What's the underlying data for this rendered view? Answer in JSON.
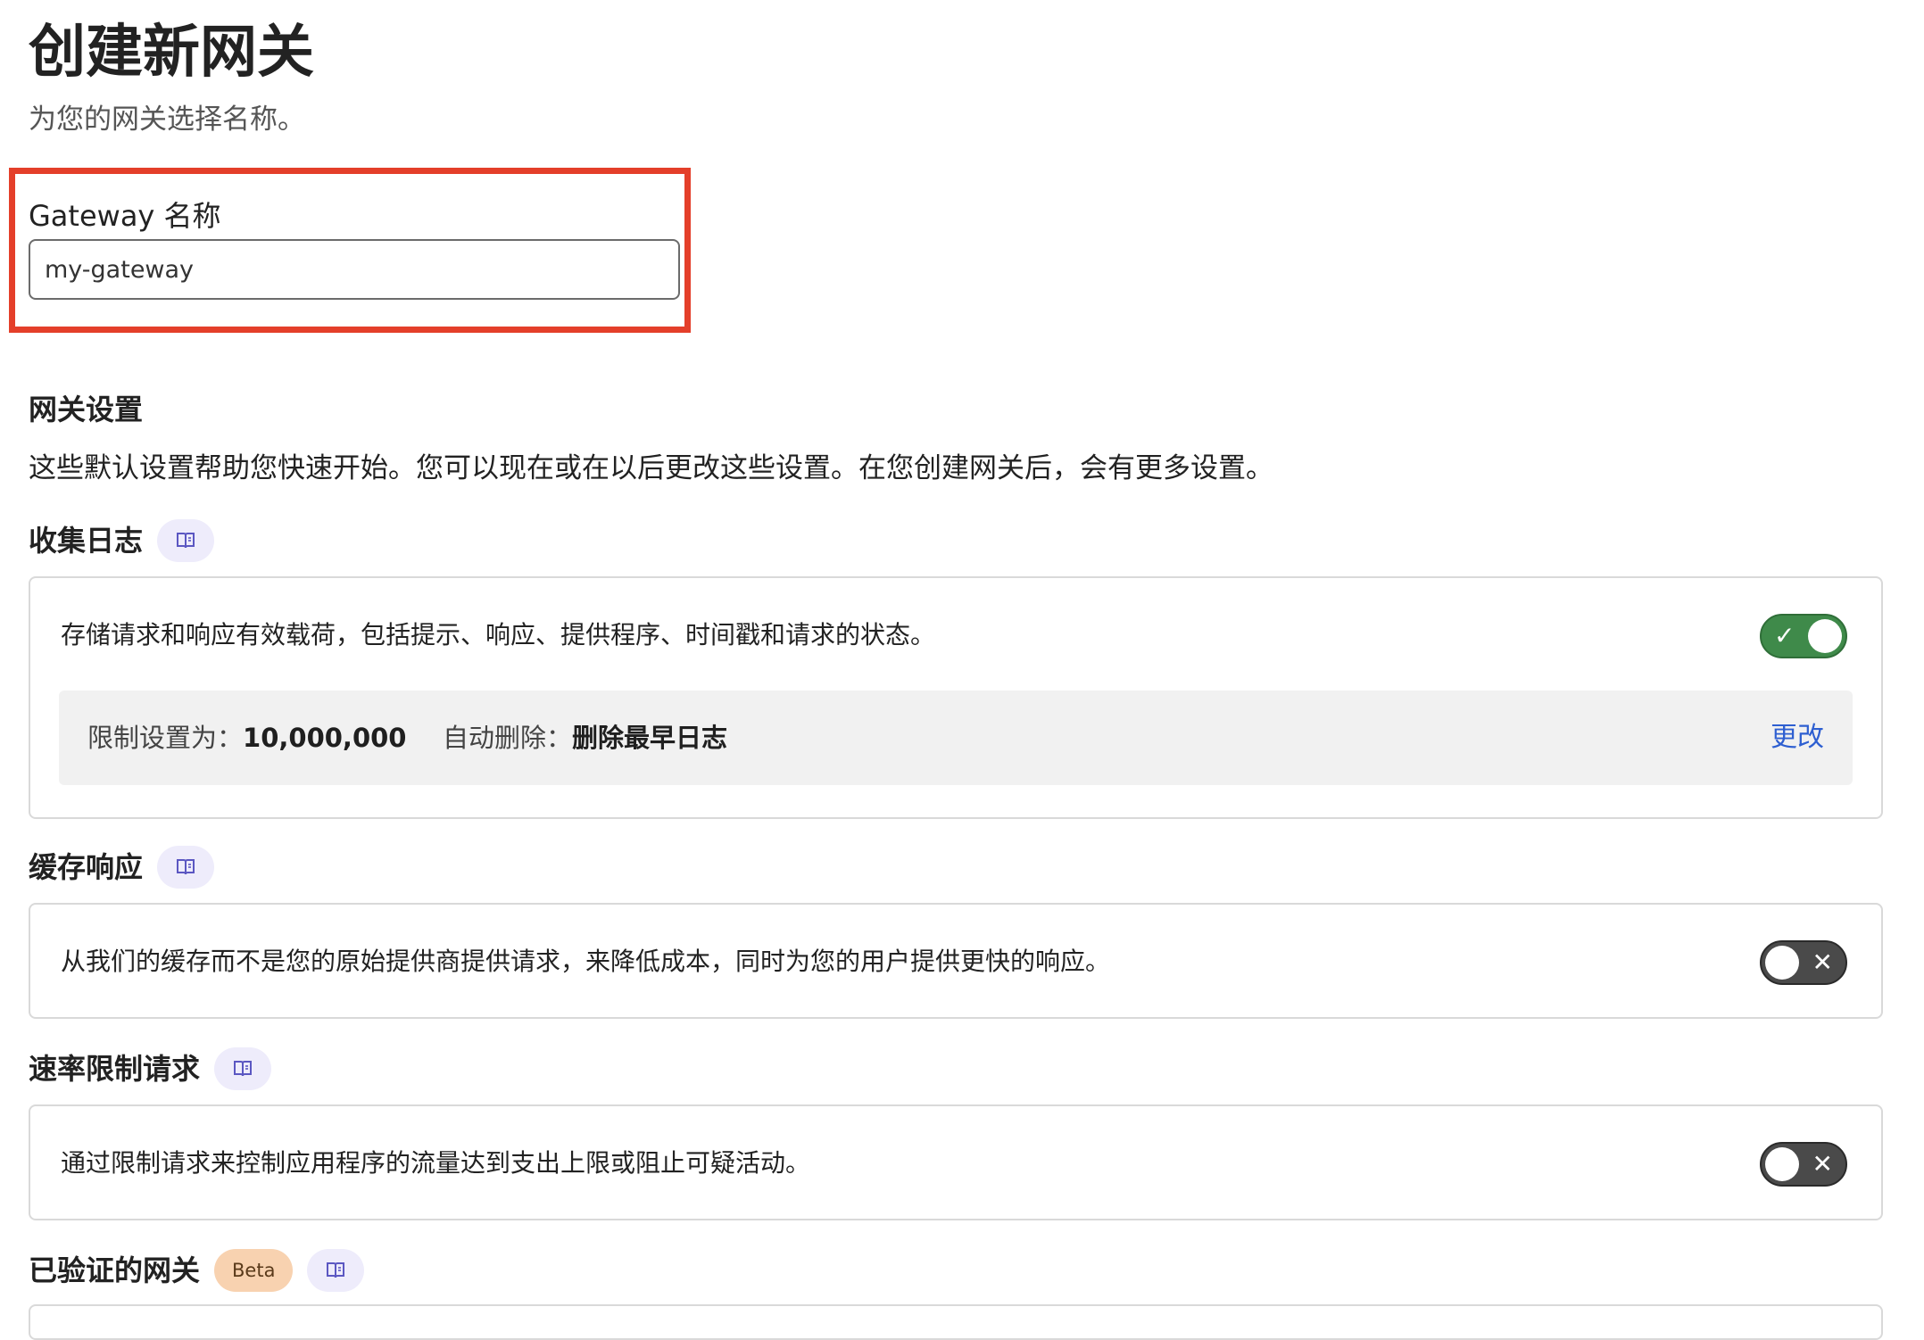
{
  "page": {
    "title": "创建新网关",
    "subtitle": "为您的网关选择名称。"
  },
  "gateway_name": {
    "label": "Gateway 名称",
    "value": "my-gateway",
    "placeholder": "my-gateway"
  },
  "settings": {
    "heading": "网关设置",
    "description": "这些默认设置帮助您快速开始。您可以现在或在以后更改这些设置。在您创建网关后，会有更多设置。"
  },
  "collect_logs": {
    "heading": "收集日志",
    "description": "存储请求和响应有效载荷，包括提示、响应、提供程序、时间戳和请求的状态。",
    "enabled": true,
    "limit_label": "限制设置为：",
    "limit_value": "10,000,000",
    "auto_delete_label": "自动删除：",
    "auto_delete_value": "删除最早日志",
    "change_label": "更改"
  },
  "cache_responses": {
    "heading": "缓存响应",
    "description": "从我们的缓存而不是您的原始提供商提供请求，来降低成本，同时为您的用户提供更快的响应。",
    "enabled": false
  },
  "rate_limit": {
    "heading": "速率限制请求",
    "description": "通过限制请求来控制应用程序的流量达到支出上限或阻止可疑活动。",
    "enabled": false
  },
  "authenticated_gateway": {
    "heading": "已验证的网关",
    "badge": "Beta"
  },
  "icons": {
    "doc": "book-icon",
    "check": "check-icon",
    "close": "close-icon"
  },
  "colors": {
    "highlight": "#e43f2a",
    "toggle_on": "#3f8a4a",
    "toggle_off": "#4a4a4a",
    "link": "#2e5fd1",
    "doc_badge": "#eeecfb",
    "beta_badge": "#f8d2b0"
  }
}
